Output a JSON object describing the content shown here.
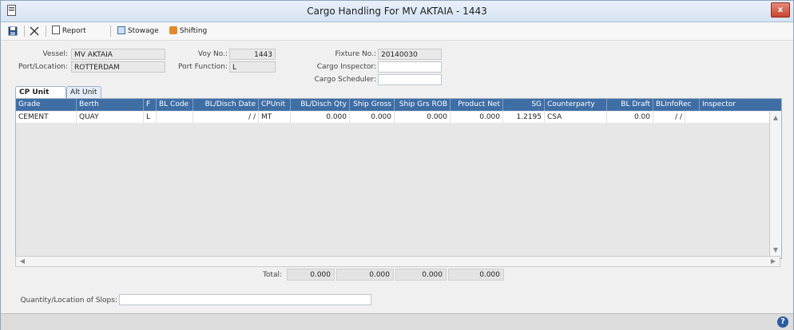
{
  "window": {
    "title": "Cargo Handling For MV AKTAIA - 1443",
    "close": "x"
  },
  "toolbar": {
    "report": "Report",
    "stowage": "Stowage",
    "shifting": "Shifting"
  },
  "form": {
    "vessel_label": "Vessel:",
    "vessel": "MV AKTAIA",
    "port_label": "Port/Location:",
    "port": "ROTTERDAM",
    "voy_label": "Voy No.:",
    "voy": "1443",
    "portfn_label": "Port Function:",
    "portfn": "L",
    "fixture_label": "Fixture No.:",
    "fixture": "20140030",
    "inspector_label": "Cargo Inspector:",
    "inspector": "",
    "scheduler_label": "Cargo Scheduler:",
    "scheduler": ""
  },
  "tabs": [
    "CP Unit",
    "Alt Unit"
  ],
  "grid": {
    "headers": [
      "Grade",
      "Berth",
      "F",
      "BL Code",
      "BL/Disch Date",
      "CPUnit",
      "BL/Disch Qty",
      "Ship Gross",
      "Ship Grs ROB",
      "Product Net",
      "SG",
      "Counterparty",
      "BL Draft",
      "BLInfoRec",
      "Inspector"
    ],
    "row": [
      "CEMENT",
      "QUAY",
      "L",
      "",
      "/ /",
      "MT",
      "0.000",
      "0.000",
      "0.000",
      "0.000",
      "1.2195",
      "CSA",
      "0.00",
      "/ /",
      ""
    ]
  },
  "totals": {
    "label": "Total:",
    "values": [
      "0.000",
      "0.000",
      "0.000",
      "0.000"
    ]
  },
  "slops": {
    "label": "Quantity/Location of Slops:",
    "value": ""
  },
  "status": {
    "help": "?"
  }
}
